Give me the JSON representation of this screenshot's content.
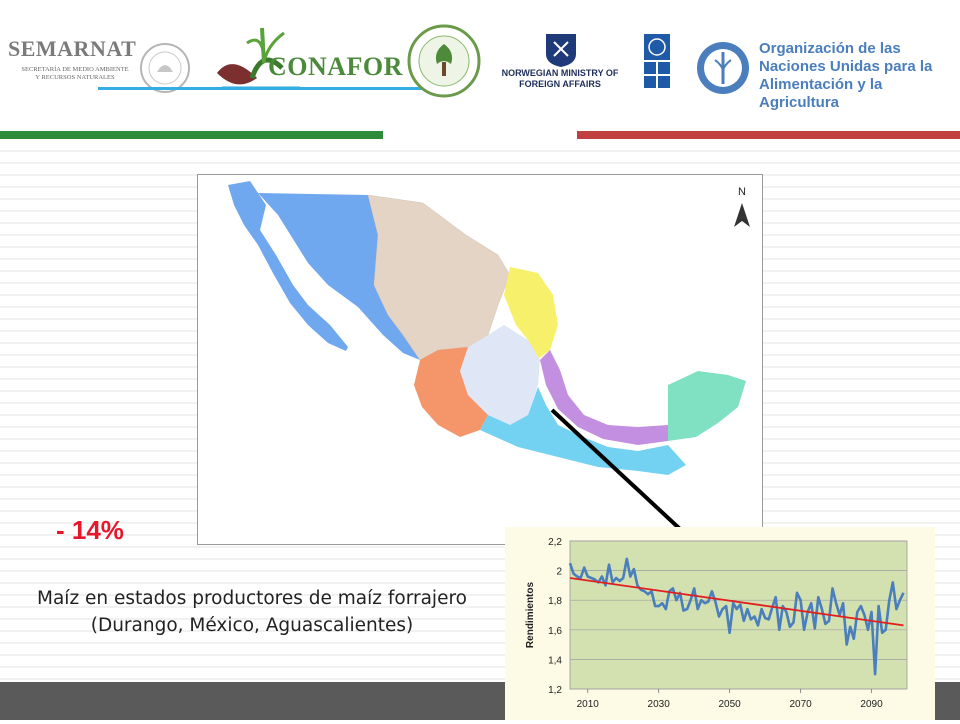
{
  "header": {
    "logos": {
      "semarnat": {
        "title": "SEMARNAT",
        "subtitle": "SECRETARÍA DE MEDIO AMBIENTE Y RECURSOS NATURALES"
      },
      "conafor": {
        "name": "CONAFOR"
      },
      "norway": {
        "name": "NORWEGIAN MINISTRY OF FOREIGN AFFAIRS"
      },
      "pnud": {
        "name": "PNUD"
      },
      "fao": {
        "name": "Organización de las Naciones Unidas para la Alimentación y la Agricultura"
      }
    },
    "colors": {
      "green": "#2e8b3a",
      "red": "#c0403f"
    }
  },
  "map": {
    "north_label": "N",
    "region_colors": [
      "#6fa8ee",
      "#e3d4c6",
      "#f7f06a",
      "#dfe6f5",
      "#f4956a",
      "#c38fe0",
      "#7fe0c2",
      "#73d1f2"
    ]
  },
  "callout": {
    "percent": "- 14%",
    "caption_line1": "Maíz en estados productores de maíz forrajero",
    "caption_line2": "(Durango, México, Aguascalientes)"
  },
  "chart_data": {
    "type": "line",
    "title": "",
    "xlabel": "",
    "ylabel": "Rendimientos",
    "xlim": [
      2005,
      2100
    ],
    "ylim": [
      1.2,
      2.2
    ],
    "xticks": [
      2010,
      2030,
      2050,
      2070,
      2090
    ],
    "yticks": [
      1.2,
      1.4,
      1.6,
      1.8,
      2.0,
      2.2
    ],
    "ytick_labels": [
      "1,2",
      "1,4",
      "1,6",
      "1,8",
      "2",
      "2,2"
    ],
    "plot_background": "#d3e1b0",
    "grid": true,
    "series": [
      {
        "color": "#4a7ebd",
        "x": [
          2005,
          2006,
          2007,
          2008,
          2009,
          2010,
          2011,
          2012,
          2013,
          2014,
          2015,
          2016,
          2017,
          2018,
          2019,
          2020,
          2021,
          2022,
          2023,
          2024,
          2025,
          2026,
          2027,
          2028,
          2029,
          2030,
          2031,
          2032,
          2033,
          2034,
          2035,
          2036,
          2037,
          2038,
          2039,
          2040,
          2041,
          2042,
          2043,
          2044,
          2045,
          2046,
          2047,
          2048,
          2049,
          2050,
          2051,
          2052,
          2053,
          2054,
          2055,
          2056,
          2057,
          2058,
          2059,
          2060,
          2061,
          2062,
          2063,
          2064,
          2065,
          2066,
          2067,
          2068,
          2069,
          2070,
          2071,
          2072,
          2073,
          2074,
          2075,
          2076,
          2077,
          2078,
          2079,
          2080,
          2081,
          2082,
          2083,
          2084,
          2085,
          2086,
          2087,
          2088,
          2089,
          2090,
          2091,
          2092,
          2093,
          2094,
          2095,
          2096,
          2097,
          2098,
          2099
        ],
        "values": [
          2.05,
          1.98,
          1.96,
          1.95,
          2.02,
          1.96,
          1.95,
          1.94,
          1.92,
          1.96,
          1.9,
          2.04,
          1.92,
          1.95,
          1.93,
          1.95,
          2.08,
          1.96,
          2.01,
          1.9,
          1.87,
          1.86,
          1.84,
          1.86,
          1.76,
          1.76,
          1.78,
          1.74,
          1.86,
          1.88,
          1.8,
          1.85,
          1.73,
          1.74,
          1.8,
          1.88,
          1.74,
          1.8,
          1.78,
          1.79,
          1.86,
          1.79,
          1.69,
          1.74,
          1.76,
          1.58,
          1.78,
          1.74,
          1.77,
          1.66,
          1.74,
          1.67,
          1.69,
          1.63,
          1.74,
          1.68,
          1.67,
          1.75,
          1.82,
          1.6,
          1.76,
          1.72,
          1.62,
          1.65,
          1.85,
          1.8,
          1.6,
          1.72,
          1.78,
          1.61,
          1.82,
          1.74,
          1.64,
          1.66,
          1.88,
          1.78,
          1.7,
          1.78,
          1.5,
          1.62,
          1.54,
          1.72,
          1.76,
          1.7,
          1.6,
          1.72,
          1.3,
          1.76,
          1.58,
          1.6,
          1.8,
          1.92,
          1.74,
          1.8,
          1.85
        ]
      },
      {
        "color": "#e02020",
        "x": [
          2005,
          2099
        ],
        "values": [
          1.95,
          1.63
        ]
      }
    ]
  }
}
